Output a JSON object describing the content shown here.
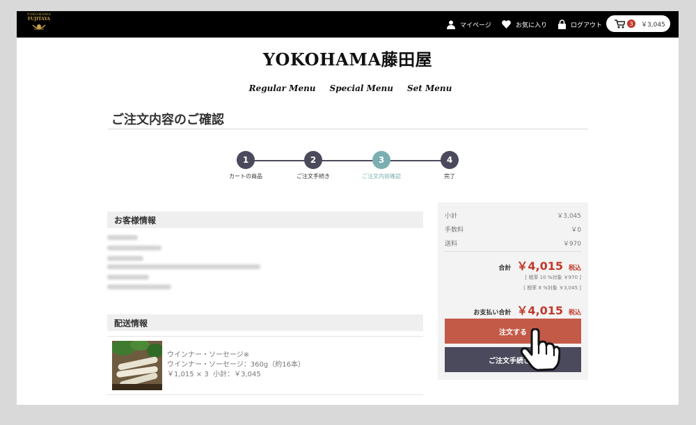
{
  "header": {
    "logo_line1": "YOKOHAMA",
    "logo_line2": "FUJITAYA",
    "logo_icon": "crest-icon",
    "mypage_label": "マイページ",
    "favorites_label": "お気に入り",
    "logout_label": "ログアウト",
    "cart_count": "3",
    "cart_total": "￥3,045",
    "icons": [
      "user-icon",
      "heart-icon",
      "lock-icon",
      "cart-icon"
    ]
  },
  "brand_title": "YOKOHAMA藤田屋",
  "menus": [
    "Regular Menu",
    "Special Menu",
    "Set Menu"
  ],
  "page_title": "ご注文内容のご確認",
  "steps": [
    {
      "num": "1",
      "label": "カートの商品"
    },
    {
      "num": "2",
      "label": "ご注文手続き"
    },
    {
      "num": "3",
      "label": "ご注文内容確認"
    },
    {
      "num": "4",
      "label": "完了"
    }
  ],
  "active_step": 3,
  "customer": {
    "heading": "お客様情報"
  },
  "shipping": {
    "heading": "配送情報",
    "item": {
      "name": "ウインナー・ソーセージ※",
      "variant": "ウインナー・ソーセージ：360g（約16本）",
      "price_qty": "￥1,015 × 3",
      "subtotal": "小計：￥3,045"
    }
  },
  "summary": {
    "subtotal_label": "小計",
    "subtotal_value": "￥3,045",
    "fee_label": "手数料",
    "fee_value": "￥0",
    "postage_label": "送料",
    "postage_value": "￥970",
    "total_label": "合計",
    "total_value": "￥4,015",
    "tax_incl": "税込",
    "tax10_note": "[ 税率 10 %対象 ￥970 ]",
    "tax8_note": "[ 税率 8 %対象 ￥3,045 ]",
    "payment_label": "お支払い合計",
    "payment_value": "￥4,015",
    "payment_tax": "税込",
    "order_button": "注文する",
    "back_button": "ご注文手続きへ"
  },
  "colors": {
    "accent_red": "#c0392b",
    "order_button": "#c35a48",
    "dark_slate": "#4a4a5c",
    "active_step": "#7aaeb0",
    "gold": "#c9a54a"
  }
}
